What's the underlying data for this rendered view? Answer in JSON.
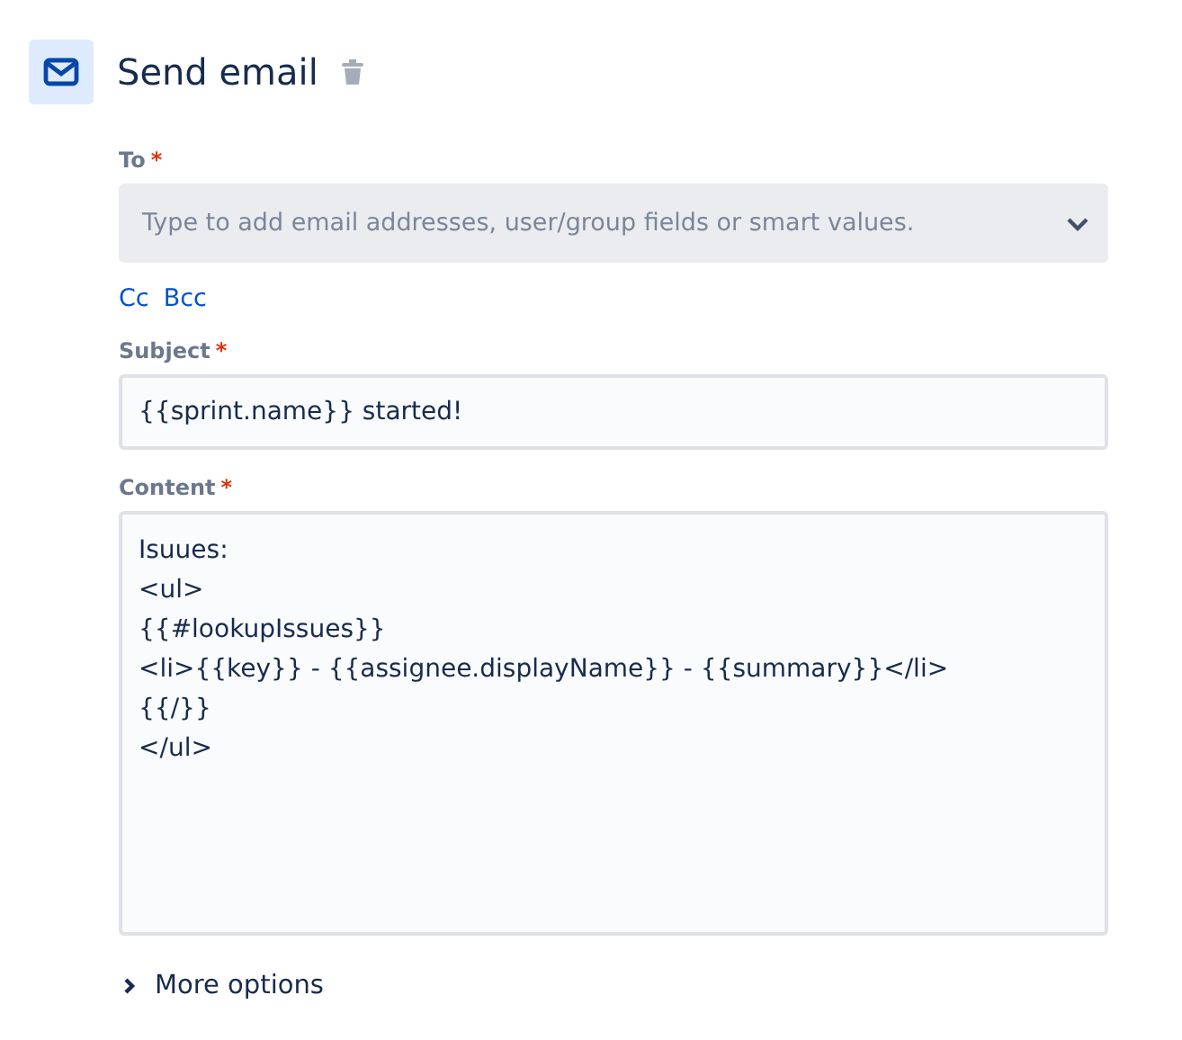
{
  "action": {
    "title": "Send email"
  },
  "fields": [
    {
      "kind": "select",
      "label": "To",
      "required_mark": "*",
      "placeholder": "Type to add email addresses, user/group fields or smart values.",
      "links": [
        "Cc",
        "Bcc"
      ]
    },
    {
      "kind": "text",
      "label": "Subject",
      "required_mark": "*",
      "value": "{{sprint.name}} started!"
    },
    {
      "kind": "textarea",
      "label": "Content",
      "required_mark": "*",
      "lines": [
        "Isuues:",
        "<ul>",
        "{{#lookupIssues}}",
        "<li>{{key}} - {{assignee.displayName}} - {{summary}}</li>",
        "{{/}}",
        "</ul>"
      ]
    }
  ],
  "more_options": {
    "label": "More options",
    "expanded": false
  }
}
